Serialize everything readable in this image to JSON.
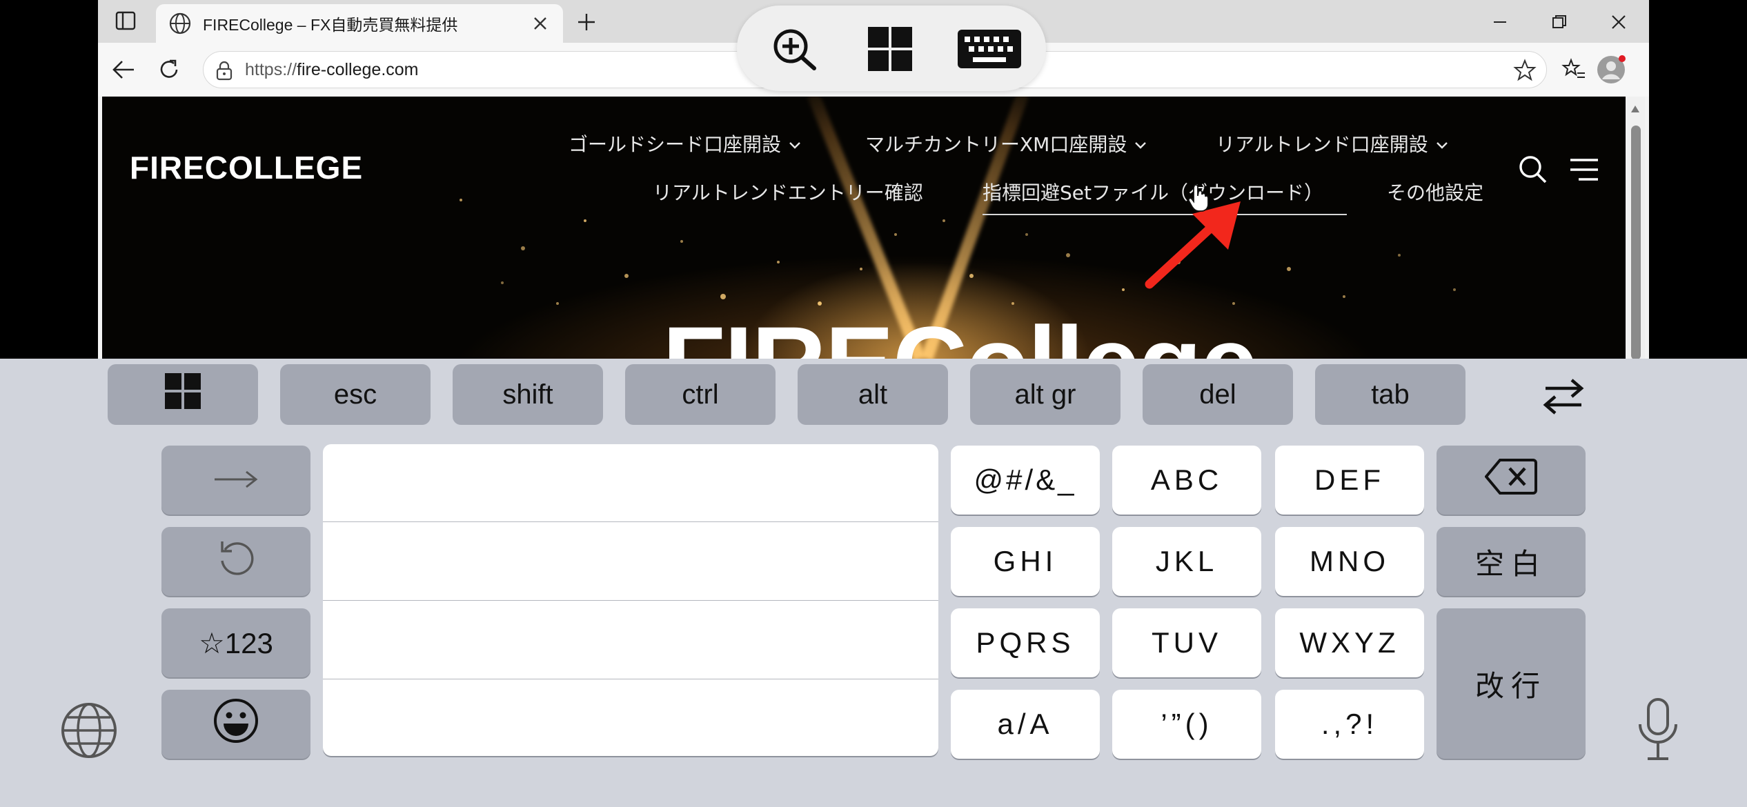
{
  "browser": {
    "tab_title": "FIRECollege – FX自動売買無料提供",
    "url_scheme": "https://",
    "url_host": "fire-college.com"
  },
  "page": {
    "logo": "FIRECOLLEGE",
    "nav": {
      "gold_seed": "ゴールドシード口座開設",
      "multi_country": "マルチカントリーXM口座開設",
      "real_trend": "リアルトレンド口座開設",
      "entry_check": "リアルトレンドエントリー確認",
      "set_file": "指標回避Setファイル（ダウンロード）",
      "other_settings": "その他設定"
    },
    "hero_title": "FIRECollege"
  },
  "icons": {
    "sidebar": "sidebar-toggle-icon",
    "favicon": "globe-icon",
    "close": "close-icon",
    "new_tab": "plus-icon",
    "back": "arrow-left-icon",
    "refresh": "refresh-icon",
    "lock": "lock-icon",
    "favorite": "star-outline-icon",
    "favorites": "favorites-list-icon",
    "profile": "profile-avatar-icon",
    "more": "more-horizontal-icon",
    "copilot": "copilot-icon",
    "search": "search-icon",
    "menu": "hamburger-menu-icon",
    "zoom": "zoom-in-icon",
    "windows": "windows-logo-icon",
    "keyboard": "keyboard-icon",
    "backspace": "backspace-icon",
    "globe": "globe-icon",
    "mic": "microphone-icon",
    "emoji": "emoji-icon",
    "switch": "swap-arrows-icon",
    "arrow": "arrow-right-icon",
    "undo": "undo-icon"
  },
  "keyboard": {
    "modifiers": [
      "esc",
      "shift",
      "ctrl",
      "alt",
      "alt gr",
      "del",
      "tab"
    ],
    "keys": {
      "symbols": "@#/&_",
      "abc": "ABC",
      "def": "DEF",
      "ghi": "GHI",
      "jkl": "JKL",
      "mno": "MNO",
      "pqrs": "PQRS",
      "tuv": "TUV",
      "wxyz": "WXYZ",
      "case": "a/A",
      "quotes": "’”()",
      "punct": ".,?!",
      "space": "空白",
      "enter": "改行",
      "numbers": "☆123"
    }
  },
  "colors": {
    "keyboard_bg": "#d1d4dc",
    "modifier_key": "#a3a7b2",
    "annotation_arrow": "#f2271c",
    "copilot_blue": "#2f7df6"
  }
}
